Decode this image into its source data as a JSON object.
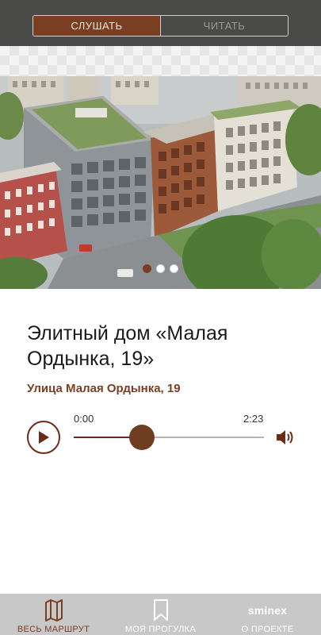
{
  "segment": {
    "listen_label": "СЛУШАТЬ",
    "read_label": "ЧИТАТЬ",
    "active": "listen"
  },
  "gallery": {
    "count": 3,
    "active_index": 0
  },
  "place": {
    "title": "Элитный дом «Малая Ордынка, 19»",
    "address": "Улица Малая Ордынка, 19"
  },
  "player": {
    "current_time": "0:00",
    "duration": "2:23",
    "progress": 0.36
  },
  "nav": {
    "items": [
      {
        "label": "ВЕСЬ МАРШРУТ",
        "icon": "map-icon",
        "active": true
      },
      {
        "label": "МОЯ ПРОГУЛКА",
        "icon": "bookmark-icon",
        "active": false
      },
      {
        "label": "О ПРОЕКТЕ",
        "icon": "sminex-logo",
        "brand": "sminex",
        "active": false
      }
    ]
  },
  "colors": {
    "accent": "#7a3f22",
    "topbar": "#4a4a48",
    "nav_bg": "#c8c8c8"
  }
}
